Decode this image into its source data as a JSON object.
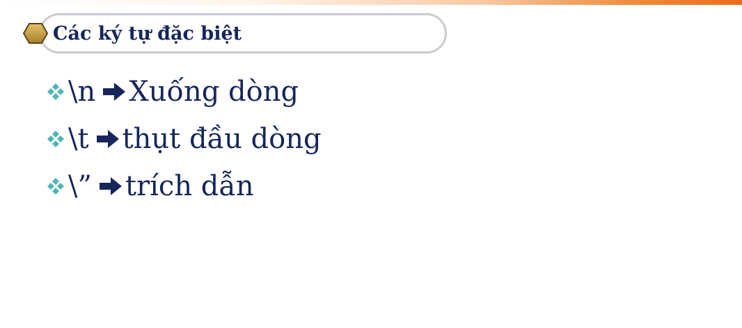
{
  "slide": {
    "title": "Các ký tự đặc biệt",
    "items": [
      {
        "code": "\\n",
        "description": "Xuống dòng"
      },
      {
        "code": "\\t",
        "description": "thụt đầu dòng"
      },
      {
        "code": "\\”",
        "description": "trích dẫn"
      }
    ]
  },
  "icons": {
    "title_marker": "hexagon-icon",
    "bullet": "four-diamond-icon",
    "arrow": "right-arrow-icon"
  },
  "colors": {
    "text": "#16265a",
    "title_marker": "#c8a13c",
    "bullet": "#4fb6b8",
    "accent_bar": "#ec6b1a",
    "pill_border": "#c9cdd2"
  }
}
